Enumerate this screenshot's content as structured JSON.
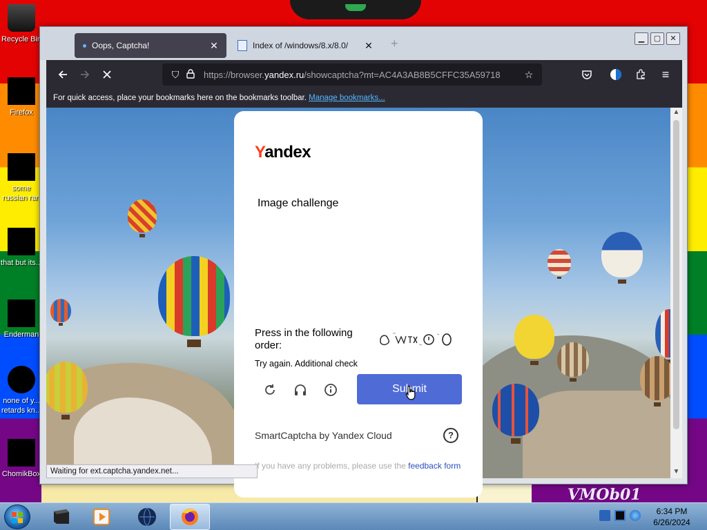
{
  "desktop": {
    "icons": [
      {
        "label": "Recycle Bin"
      },
      {
        "label": "Firefox"
      },
      {
        "label": "some russian ran a ra..."
      },
      {
        "label": "that but its..."
      },
      {
        "label": "Enderman"
      },
      {
        "label": "none of y... retards kn..."
      },
      {
        "label": "ChomikBox"
      }
    ],
    "watermark": "VMOb01"
  },
  "browser": {
    "tabs": [
      {
        "title": "Oops, Captcha!",
        "active": true
      },
      {
        "title": "Index of /windows/8.x/8.0/",
        "active": false
      }
    ],
    "new_tab": "+",
    "url_prefix": "https://browser.",
    "url_domain": "yandex.ru",
    "url_path": "/showcaptcha?mt=AC4A3AB8B5CFFC35A59718",
    "bookmarks_text": "For quick access, place your bookmarks here on the bookmarks toolbar.",
    "bookmarks_link": "Manage bookmarks...",
    "status_text": "Waiting for ext.captcha.yandex.net..."
  },
  "captcha": {
    "logo_first": "Y",
    "logo_rest": "andex",
    "challenge_title": "Image challenge",
    "instruction": "Press in the following order:",
    "retry_text": "Try again. Additional check",
    "submit_label": "Submit",
    "provider": "SmartCaptcha by Yandex Cloud",
    "help": "?",
    "feedback_text": "If you have any problems, please use the",
    "feedback_link": "feedback form"
  },
  "taskbar": {
    "time": "6:34 PM",
    "date": "6/26/2024"
  },
  "colors": {
    "accent": "#4f6bd6",
    "yandex_red": "#fc3f1d",
    "browser_dark": "#2b2a33"
  }
}
